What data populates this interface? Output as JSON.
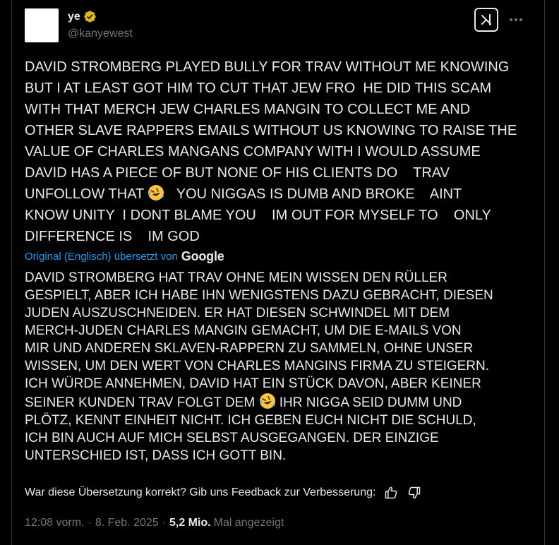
{
  "author": {
    "display_name": "ye",
    "handle": "@kanyewest",
    "verified_badge_color": "#e2b719",
    "avatar_color": "#ffffff"
  },
  "header_actions": {
    "grok_icon": "grok-icon",
    "more_icon": "more-icon"
  },
  "tweet": {
    "line_1": "DAVID STROMBERG PLAYED BULLY FOR TRAV WITHOUT ME KNOWING",
    "line_2": "BUT I AT LEAST GOT HIM TO CUT THAT JEW FRO  HE DID THIS SCAM",
    "line_3": "WITH THAT MERCH JEW CHARLES MANGIN TO COLLECT ME AND",
    "line_4": "OTHER SLAVE RAPPERS EMAILS WITHOUT US KNOWING TO RAISE THE",
    "line_5": "VALUE OF CHARLES MANGANS COMPANY WITH I WOULD ASSUME",
    "line_6": "DAVID HAS A PIECE OF BUT NONE OF HIS CLIENTS DO    TRAV",
    "line_7_a": "UNFOLLOW THAT ",
    "line_7_b": "   YOU NIGGAS IS DUMB AND BROKE    AINT",
    "line_8": "KNOW UNITY  I DONT BLAME YOU    IM OUT FOR MYSELF TO    ONLY",
    "line_9": "DIFFERENCE IS    IM GOD",
    "emoji": "rolling-on-floor-laughing-emoji"
  },
  "translation": {
    "label": "Original (Englisch) übersetzt von",
    "provider": "Google",
    "line_1": "DAVID STROMBERG HAT TRAV OHNE MEIN WISSEN DEN RÜLLER",
    "line_2": "GESPIELT, ABER ICH HABE IHN WENIGSTENS DAZU GEBRACHT, DIESEN",
    "line_3": "JUDEN AUSZUSCHNEIDEN. ER HAT DIESEN SCHWINDEL MIT DEM",
    "line_4": "MERCH-JUDEN CHARLES MANGIN GEMACHT, UM DIE E-MAILS VON",
    "line_5": "MIR UND ANDEREN SKLAVEN-RAPPERN ZU SAMMELN, OHNE UNSER",
    "line_6": "WISSEN, UM DEN WERT VON CHARLES MANGINS FIRMA ZU STEIGERN.",
    "line_7": "ICH WÜRDE ANNEHMEN, DAVID HAT EIN STÜCK DAVON, ABER KEINER",
    "line_8_a": "SEINER KUNDEN TRAV FOLGT DEM ",
    "line_8_b": " IHR NIGGA SEID DUMM UND",
    "line_9": "PLÖTZ, KENNT EINHEIT NICHT. ICH GEBEN EUCH NICHT DIE SCHULD,",
    "line_10": "ICH BIN AUCH AUF MICH SELBST AUSGEGANGEN. DER EINZIGE",
    "line_11": "UNTERSCHIED IST, DASS ICH GOTT BIN."
  },
  "feedback": {
    "prompt": "War diese Übersetzung korrekt? Gib uns Feedback zur Verbesserung:",
    "thumbs_up_icon": "thumbs-up-icon",
    "thumbs_down_icon": "thumbs-down-icon"
  },
  "meta": {
    "time": "12:08 vorm.",
    "date": "8. Feb. 2025",
    "views_count": "5,2 Mio.",
    "views_label": "Mal angezeigt"
  }
}
